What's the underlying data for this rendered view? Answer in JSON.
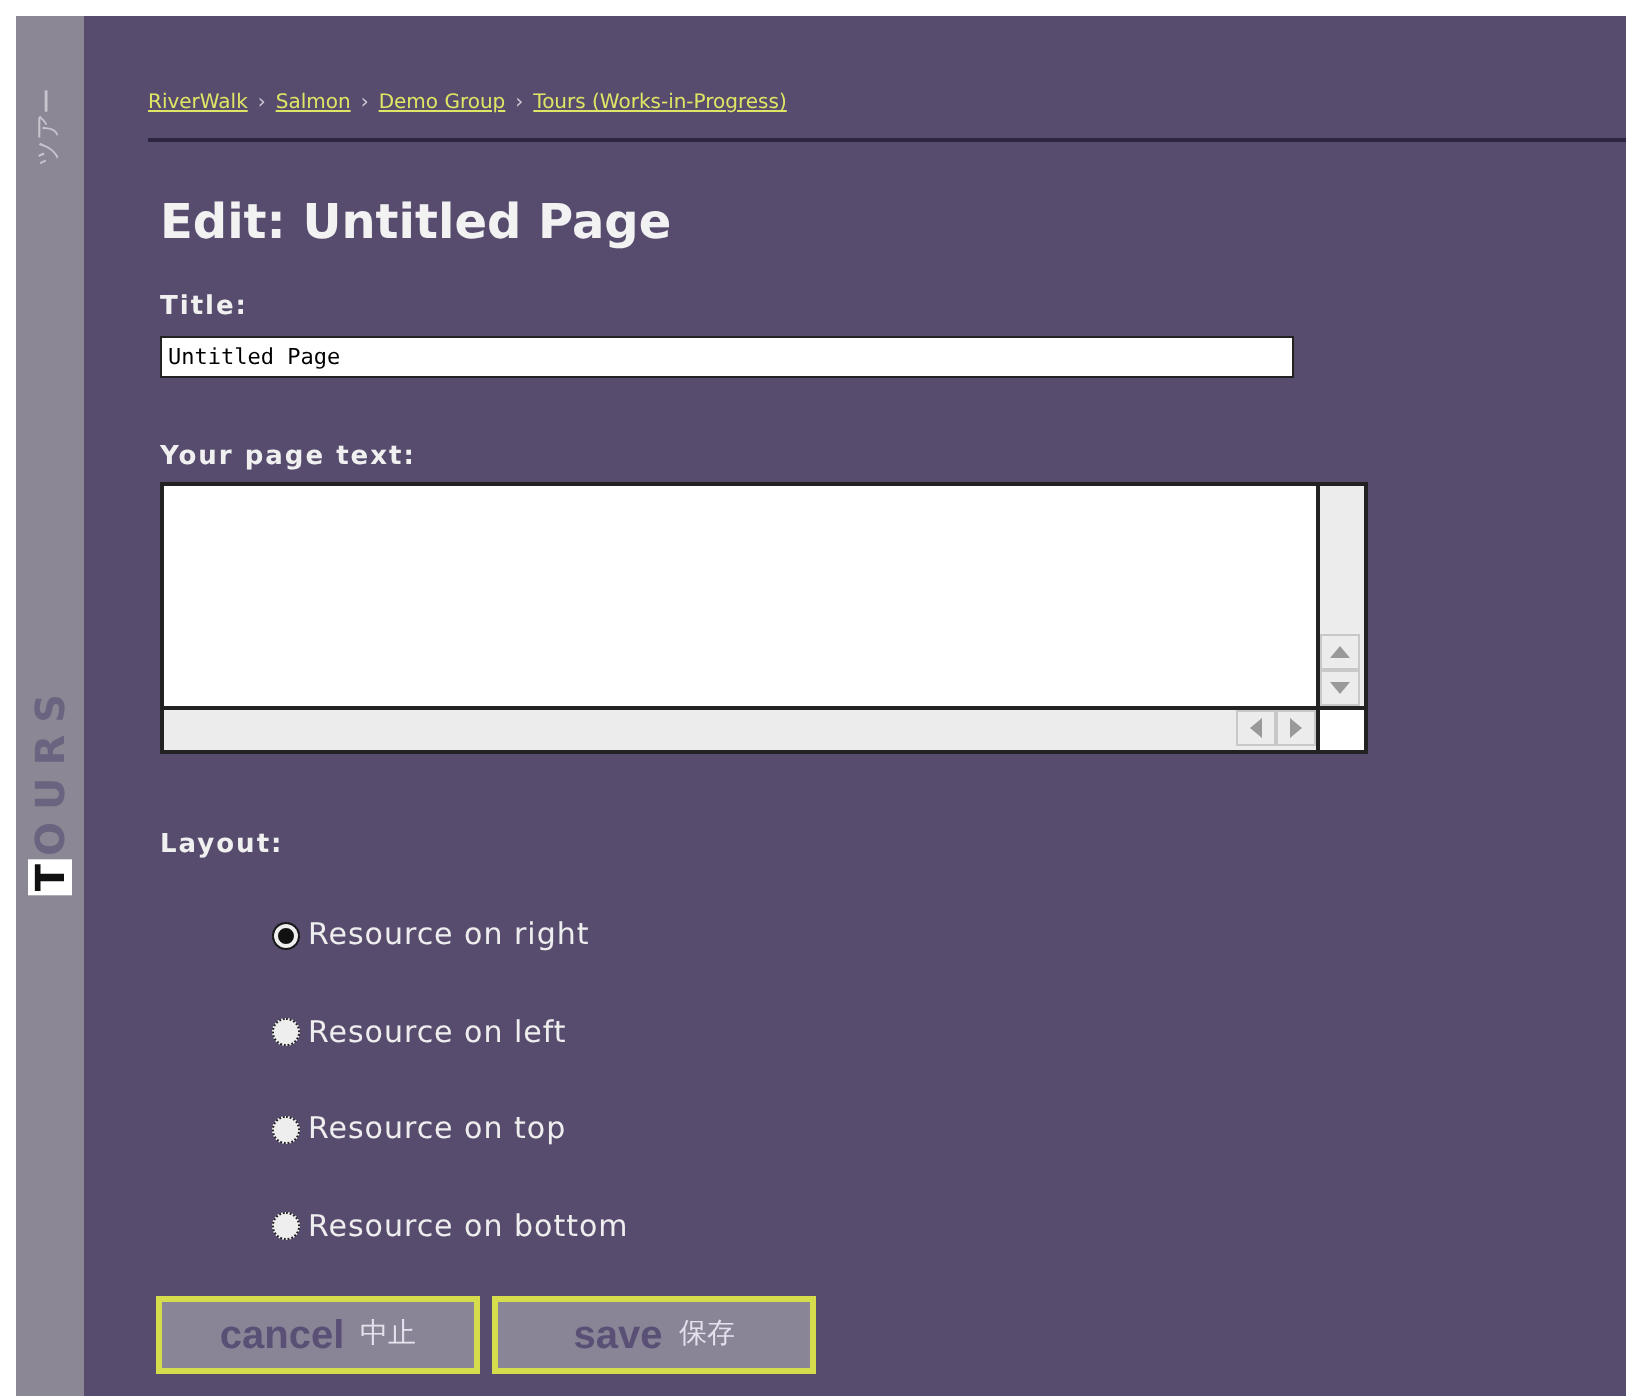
{
  "sidebar": {
    "label_ja": "ツアー",
    "title_initial": "T",
    "title_rest": "OURS"
  },
  "breadcrumb": [
    "RiverWalk",
    "Salmon",
    "Demo Group",
    "Tours (Works-in-Progress)"
  ],
  "breadcrumb_separator": "›",
  "heading": "Edit: Untitled Page",
  "title_field": {
    "label": "Title:",
    "value": "Untitled Page"
  },
  "text_field": {
    "label": "Your page text:"
  },
  "layout": {
    "label": "Layout:",
    "options": [
      {
        "label": "Resource on right",
        "selected": true
      },
      {
        "label": "Resource on left",
        "selected": false
      },
      {
        "label": "Resource on top",
        "selected": false
      },
      {
        "label": "Resource on bottom",
        "selected": false
      }
    ]
  },
  "buttons": [
    {
      "label": "cancel",
      "label_ja": "中止"
    },
    {
      "label": "save",
      "label_ja": "保存"
    }
  ]
}
